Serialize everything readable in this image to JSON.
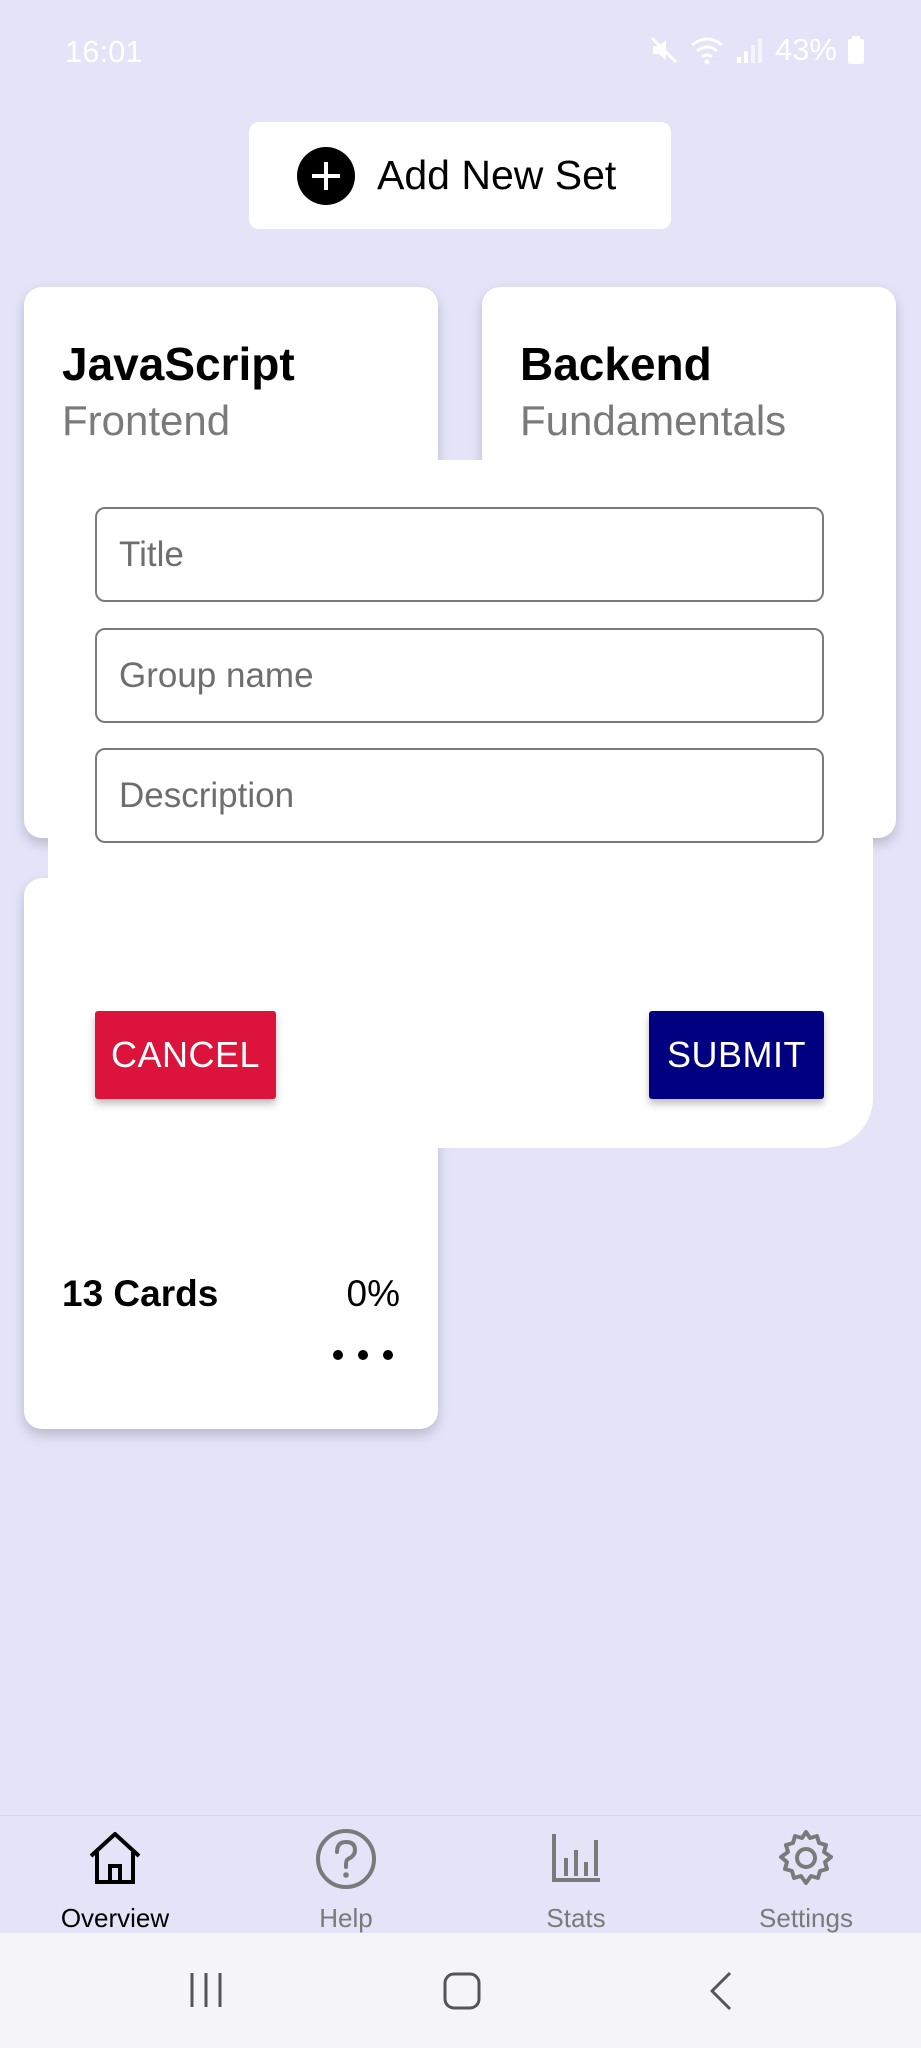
{
  "status_bar": {
    "time": "16:01",
    "battery": "43%"
  },
  "add_set": {
    "label": "Add New Set"
  },
  "cards": [
    {
      "title": "JavaScript",
      "subtitle": "Frontend"
    },
    {
      "title": "Backend",
      "subtitle": "Fundamentals"
    },
    {
      "count": "13 Cards",
      "progress": "0%"
    }
  ],
  "form": {
    "title_placeholder": "Title",
    "group_placeholder": "Group name",
    "description_placeholder": "Description",
    "cancel_label": "CANCEL",
    "submit_label": "SUBMIT"
  },
  "bottom_nav": {
    "items": [
      {
        "label": "Overview",
        "icon": "home-icon",
        "active": true
      },
      {
        "label": "Help",
        "icon": "help-icon",
        "active": false
      },
      {
        "label": "Stats",
        "icon": "stats-icon",
        "active": false
      },
      {
        "label": "Settings",
        "icon": "settings-icon",
        "active": false
      }
    ]
  },
  "colors": {
    "background": "#e4e3f8",
    "cancel": "#dc143c",
    "submit": "#000080",
    "inactive_nav": "#7a7a7a"
  }
}
